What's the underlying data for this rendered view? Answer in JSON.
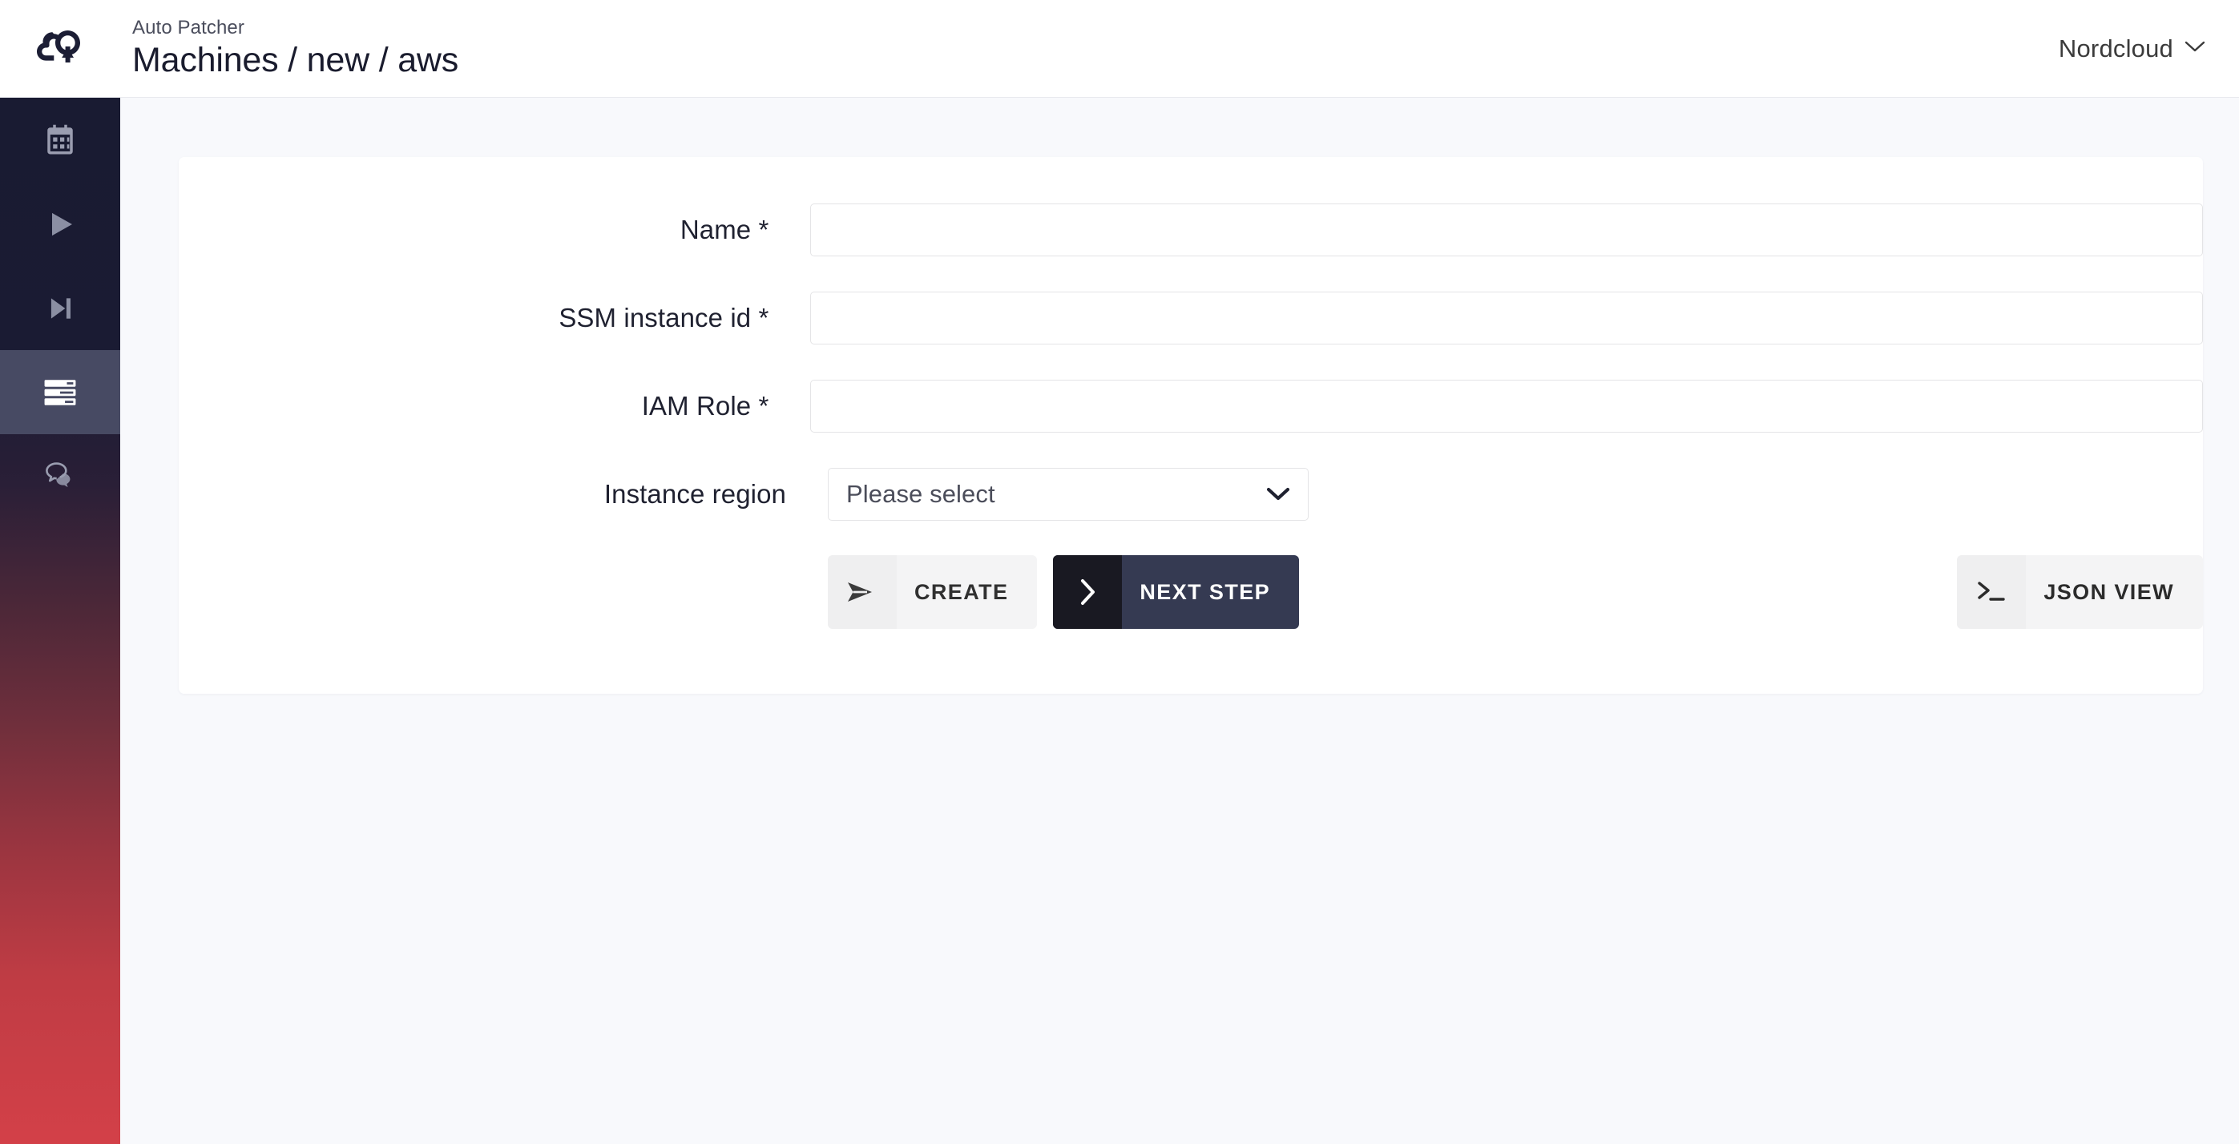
{
  "header": {
    "logo_icon": "cloud-upload-logo",
    "app_label": "Auto Patcher",
    "page_title": "Machines / new / aws",
    "user": {
      "name": "Nordcloud",
      "chevron_icon": "chevron-down-icon"
    }
  },
  "sidebar": {
    "items": [
      {
        "name": "calendar",
        "icon": "calendar-icon",
        "active": false
      },
      {
        "name": "play",
        "icon": "play-icon",
        "active": false
      },
      {
        "name": "skip-next",
        "icon": "skip-next-icon",
        "active": false
      },
      {
        "name": "machines",
        "icon": "servers-icon",
        "active": true
      },
      {
        "name": "chat",
        "icon": "chat-bubbles-icon",
        "active": false
      }
    ],
    "gradient_from": "#191b32",
    "gradient_to": "#d34048",
    "active_background": "#474a63"
  },
  "form": {
    "fields": [
      {
        "label": "Name *",
        "value": "",
        "placeholder": "",
        "type": "text"
      },
      {
        "label": "SSM instance id *",
        "value": "",
        "placeholder": "",
        "type": "text"
      },
      {
        "label": "IAM Role *",
        "value": "",
        "placeholder": "",
        "type": "text"
      }
    ],
    "select": {
      "label": "Instance region",
      "value": "Please select",
      "chevron_icon": "chevron-down-icon"
    }
  },
  "actions": {
    "create": {
      "label": "CREATE",
      "icon": "send-icon"
    },
    "next_step": {
      "label": "NEXT STEP",
      "icon": "chevron-right-icon"
    },
    "json_view": {
      "label": "JSON VIEW",
      "icon": "terminal-icon"
    }
  },
  "colors": {
    "page_background": "#f8f9fc",
    "card_background": "#ffffff",
    "primary_dark": "#353a52",
    "primary_darker": "#191922",
    "accent_red": "#d34048"
  }
}
